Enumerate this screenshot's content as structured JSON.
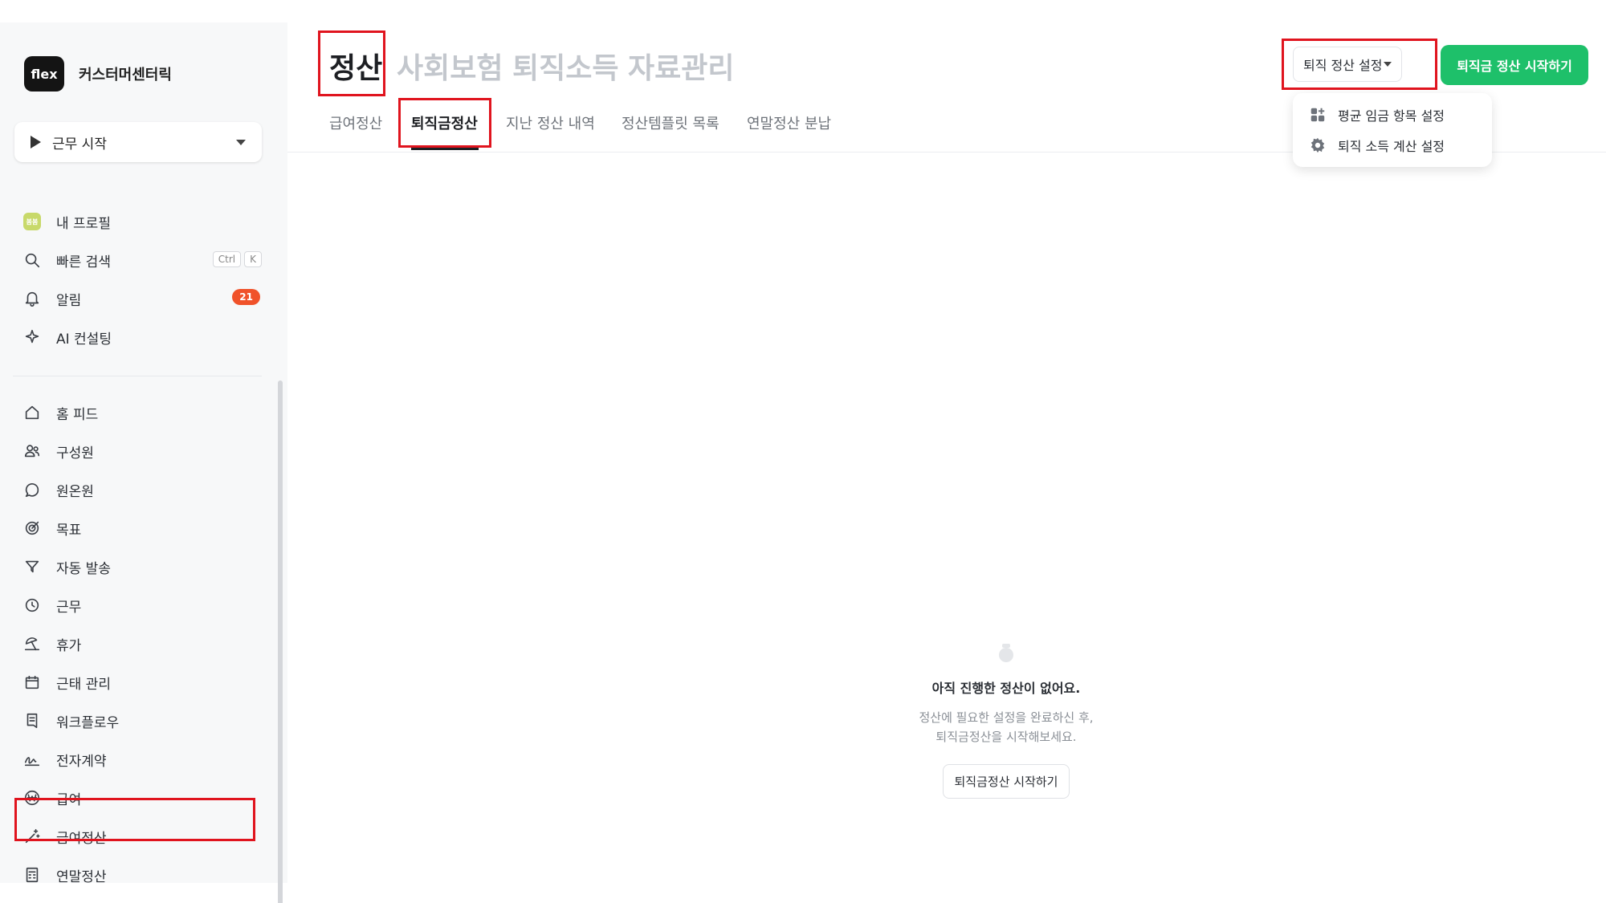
{
  "brand": {
    "logo": "flex",
    "name": "커스터머센터릭"
  },
  "work_start": {
    "label": "근무 시작"
  },
  "sidebar_top": [
    {
      "label": "내 프로필",
      "icon": "avatar-icon",
      "avatar_text": "봄봄"
    },
    {
      "label": "빠른 검색",
      "icon": "search-icon",
      "shortcut": [
        "Ctrl",
        "K"
      ]
    },
    {
      "label": "알림",
      "icon": "bell-icon",
      "badge": "21"
    },
    {
      "label": "AI 컨설팅",
      "icon": "sparkle-icon"
    }
  ],
  "sidebar_main": [
    {
      "label": "홈 피드",
      "icon": "home-icon"
    },
    {
      "label": "구성원",
      "icon": "people-icon"
    },
    {
      "label": "원온원",
      "icon": "chat-icon"
    },
    {
      "label": "목표",
      "icon": "target-icon"
    },
    {
      "label": "자동 발송",
      "icon": "send-icon"
    },
    {
      "label": "근무",
      "icon": "clock-icon"
    },
    {
      "label": "휴가",
      "icon": "beach-icon"
    },
    {
      "label": "근태 관리",
      "icon": "calendar-icon"
    },
    {
      "label": "워크플로우",
      "icon": "document-icon"
    },
    {
      "label": "전자계약",
      "icon": "signature-icon"
    },
    {
      "label": "급여",
      "icon": "won-icon"
    },
    {
      "label": "급여정산",
      "icon": "magic-wand-icon"
    },
    {
      "label": "연말정산",
      "icon": "calculator-icon"
    }
  ],
  "header": {
    "big_tabs": [
      "정산",
      "사회보험",
      "퇴직소득",
      "자료관리"
    ],
    "sub_tabs": [
      "급여정산",
      "퇴직금정산",
      "지난 정산 내역",
      "정산템플릿 목록",
      "연말정산 분납"
    ],
    "setting_button": "퇴직 정산 설정",
    "start_button": "퇴직금 정산 시작하기"
  },
  "dropdown": [
    {
      "label": "평균 임금 항목 설정",
      "icon": "grid-plus-icon"
    },
    {
      "label": "퇴직 소득 계산 설정",
      "icon": "gear-icon"
    }
  ],
  "empty_state": {
    "title": "아직 진행한 정산이 없어요.",
    "desc_line1": "정산에 필요한 설정을 완료하신 후,",
    "desc_line2": "퇴직금정산을 시작해보세요.",
    "button": "퇴직금정산 시작하기"
  },
  "colors": {
    "accent_green": "#1ec06a",
    "highlight_red": "#e0141e",
    "badge_orange": "#f0522a"
  }
}
